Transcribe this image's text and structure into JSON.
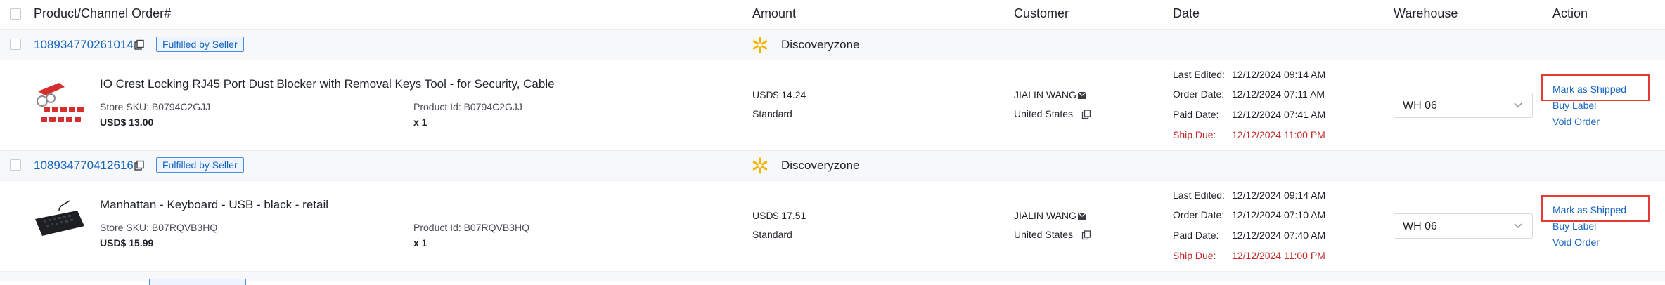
{
  "header": {
    "product_col": "Product/Channel Order#",
    "amount_col": "Amount",
    "customer_col": "Customer",
    "date_col": "Date",
    "warehouse_col": "Warehouse",
    "action_col": "Action"
  },
  "orders": [
    {
      "order_number": "108934770261014",
      "fulfillment_tag": "Fulfilled by Seller",
      "store_name": "Discoveryzone",
      "product": {
        "title": "IO Crest Locking RJ45 Port Dust Blocker with Removal Keys Tool - for Security, Cable",
        "store_sku": "Store SKU: B0794C2GJJ",
        "price": "USD$ 13.00",
        "product_id": "Product Id: B0794C2GJJ",
        "quantity": "x 1",
        "image_icon": "rj45-dust-blocker-image"
      },
      "amount": {
        "total": "USD$ 14.24",
        "shipping": "Standard"
      },
      "customer": {
        "name": "JIALIN WANG",
        "country": "United States"
      },
      "dates": {
        "last_edited_label": "Last Edited:",
        "last_edited": "12/12/2024 09:14 AM",
        "order_date_label": "Order Date:",
        "order_date": "12/12/2024 07:11 AM",
        "paid_date_label": "Paid Date:",
        "paid_date": "12/12/2024 07:41 AM",
        "ship_due_label": "Ship Due:",
        "ship_due": "12/12/2024 11:00 PM"
      },
      "warehouse": "WH 06",
      "actions": {
        "mark_shipped": "Mark as Shipped",
        "buy_label": "Buy Label",
        "void_order": "Void Order"
      }
    },
    {
      "order_number": "108934770412616",
      "fulfillment_tag": "Fulfilled by Seller",
      "store_name": "Discoveryzone",
      "product": {
        "title": "Manhattan - Keyboard - USB - black - retail",
        "store_sku": "Store SKU: B07RQVB3HQ",
        "price": "USD$ 15.99",
        "product_id": "Product Id: B07RQVB3HQ",
        "quantity": "x 1",
        "image_icon": "keyboard-image"
      },
      "amount": {
        "total": "USD$ 17.51",
        "shipping": "Standard"
      },
      "customer": {
        "name": "JIALIN WANG",
        "country": "United States"
      },
      "dates": {
        "last_edited_label": "Last Edited:",
        "last_edited": "12/12/2024 09:14 AM",
        "order_date_label": "Order Date:",
        "order_date": "12/12/2024 07:10 AM",
        "paid_date_label": "Paid Date:",
        "paid_date": "12/12/2024 07:40 AM",
        "ship_due_label": "Ship Due:",
        "ship_due": "12/12/2024 11:00 PM"
      },
      "warehouse": "WH 06",
      "actions": {
        "mark_shipped": "Mark as Shipped",
        "buy_label": "Buy Label",
        "void_order": "Void Order"
      }
    }
  ],
  "colors": {
    "link": "#1565c0",
    "ship_due": "#c62828",
    "highlight": "#e53935",
    "walmart_spark": "#f5b301"
  }
}
